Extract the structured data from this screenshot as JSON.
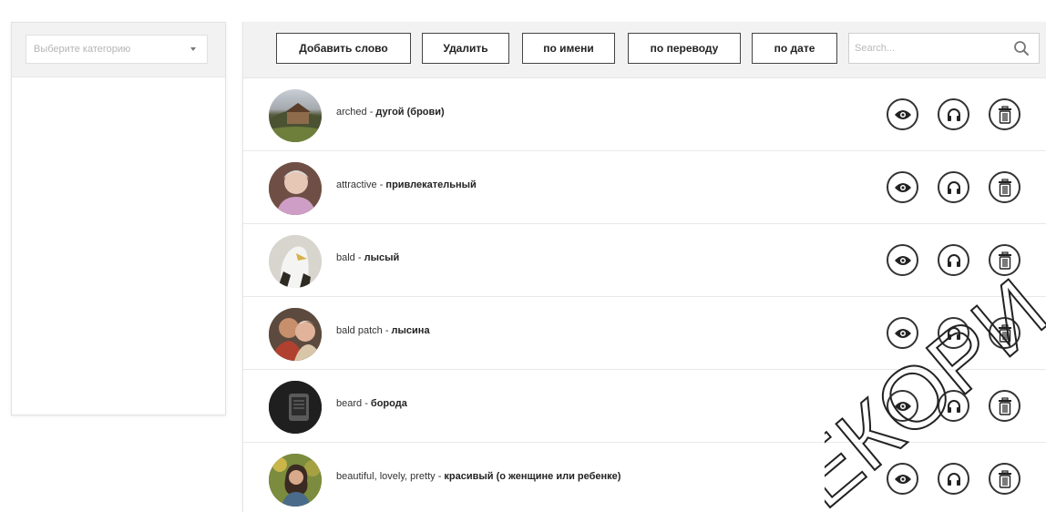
{
  "sidebar": {
    "category_select": {
      "placeholder": "Выберите категорию"
    }
  },
  "toolbar": {
    "add_word_label": "Добавить слово",
    "delete_label": "Удалить",
    "sort_by_name_label": "по имени",
    "sort_by_translation_label": "по переводу",
    "sort_by_date_label": "по дате",
    "search_placeholder": "Search..."
  },
  "words": [
    {
      "word": "arched",
      "translation": "дугой (брови)"
    },
    {
      "word": "attractive",
      "translation": "привлекательный"
    },
    {
      "word": "bald",
      "translation": "лысый"
    },
    {
      "word": "bald patch",
      "translation": "лысина"
    },
    {
      "word": "beard",
      "translation": "борода"
    },
    {
      "word": "beautiful, lovely, pretty",
      "translation": "красивый (о женщине или ребенке)"
    }
  ],
  "row_actions": [
    "eye-icon",
    "headphones-icon",
    "trash-icon"
  ],
  "watermark": {
    "text": "ЕКОРИ"
  },
  "colors": {
    "toolbar_bg": "#f2f2f2",
    "border_dark": "#333333",
    "watermark": "#222222"
  }
}
